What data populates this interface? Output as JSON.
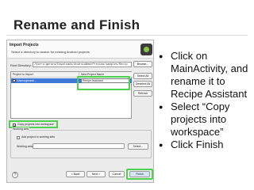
{
  "slide": {
    "title": "Rename and Finish",
    "bullets": [
      "Click on MainActivity, and rename it to Recipe Assistant",
      "Select “Copy projects into workspace”",
      "Click Finish"
    ]
  },
  "dialog": {
    "title": "Import Projects",
    "subtitle": "Select a directory to search for existing Android projects",
    "root_label": "Root Directory:",
    "root_value": "/Users/gerard/Downloads/AndroidWearPreview/samples/Recip",
    "browse_label": "Browse...",
    "columns": [
      "Project to Import",
      "New Project Name"
    ],
    "rows": [
      {
        "project": "/Users/gerard/...",
        "new_name": "Recipe Assistant",
        "checked": true
      }
    ],
    "select_all_label": "Select All",
    "deselect_all_label": "Deselect All",
    "refresh_label": "Refresh",
    "copy_label": "Copy projects into workspace",
    "copy_checked": true,
    "working_sets_legend": "Working sets",
    "add_to_ws_label": "Add project to working sets",
    "working_sets_label": "Working sets:",
    "select_label": "Select...",
    "help_symbol": "?",
    "back_label": "< Back",
    "next_label": "Next >",
    "cancel_label": "Cancel",
    "finish_label": "Finish",
    "check_mark": "✓"
  },
  "colors": {
    "highlight": "#4fd04f",
    "selection": "#3d78d8"
  }
}
